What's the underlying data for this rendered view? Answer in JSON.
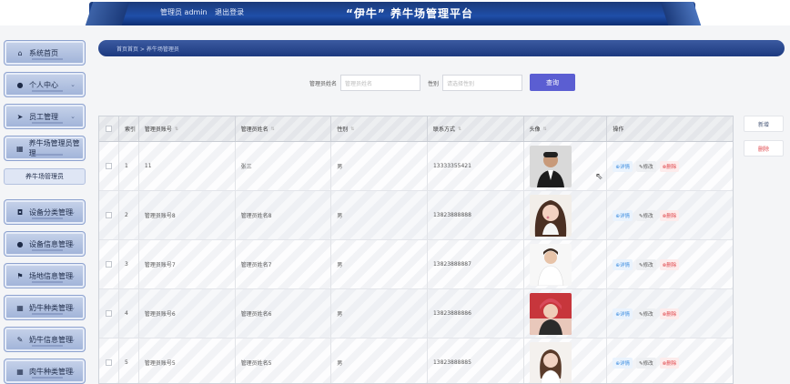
{
  "header": {
    "user_label": "管理员 admin",
    "logout": "退出登录",
    "site_title": "“伊牛” 养牛场管理平台"
  },
  "sidebar": {
    "items": [
      {
        "label": "系统首页",
        "icon": "home-icon",
        "glyph": "⌂"
      },
      {
        "label": "个人中心",
        "icon": "user-icon",
        "glyph": "●"
      },
      {
        "label": "员工管理",
        "icon": "send-icon",
        "glyph": "➤"
      },
      {
        "label": "养牛场管理员管理",
        "icon": "grid-icon",
        "glyph": "▦"
      },
      {
        "label": "设备分类管理",
        "icon": "tablet-icon",
        "glyph": "◘"
      },
      {
        "label": "设备信息管理",
        "icon": "user-icon",
        "glyph": "●"
      },
      {
        "label": "场地信息管理",
        "icon": "flag-icon",
        "glyph": "⚑"
      },
      {
        "label": "奶牛种类管理",
        "icon": "grid-icon",
        "glyph": "▦"
      },
      {
        "label": "奶牛信息管理",
        "icon": "thumb-icon",
        "glyph": "✎"
      },
      {
        "label": "肉牛种类管理",
        "icon": "grid-icon",
        "glyph": "▦"
      }
    ],
    "submenu_label": "养牛场管理员"
  },
  "breadcrumb": "首页首页 > 养牛场管理员",
  "search": {
    "name_label": "管理员姓名",
    "name_placeholder": "管理员姓名",
    "sex_label": "性别",
    "sex_placeholder": "请选择性别",
    "query_button": "查询"
  },
  "actions": {
    "add": "新增",
    "delete": "删除"
  },
  "table": {
    "headers": {
      "idx": "索引",
      "account": "管理员账号",
      "name": "管理员姓名",
      "sex": "性别",
      "phone": "联系方式",
      "avatar": "头像",
      "op": "操作"
    },
    "op_labels": {
      "detail": "详情",
      "edit": "修改",
      "del": "删除"
    },
    "rows": [
      {
        "idx": "1",
        "account": "11",
        "name": "张三",
        "sex": "男",
        "phone": "13333355421"
      },
      {
        "idx": "2",
        "account": "管理员账号8",
        "name": "管理员姓名8",
        "sex": "男",
        "phone": "13823888888"
      },
      {
        "idx": "3",
        "account": "管理员账号7",
        "name": "管理员姓名7",
        "sex": "男",
        "phone": "13823888887"
      },
      {
        "idx": "4",
        "account": "管理员账号6",
        "name": "管理员姓名6",
        "sex": "男",
        "phone": "13823888886"
      },
      {
        "idx": "5",
        "account": "管理员账号5",
        "name": "管理员姓名5",
        "sex": "男",
        "phone": "13823888885"
      }
    ]
  },
  "colors": {
    "header_blue": "#1f4ea8",
    "query_purple": "#5b5ed2",
    "danger": "#e0474c",
    "link_blue": "#3f8ee0"
  }
}
